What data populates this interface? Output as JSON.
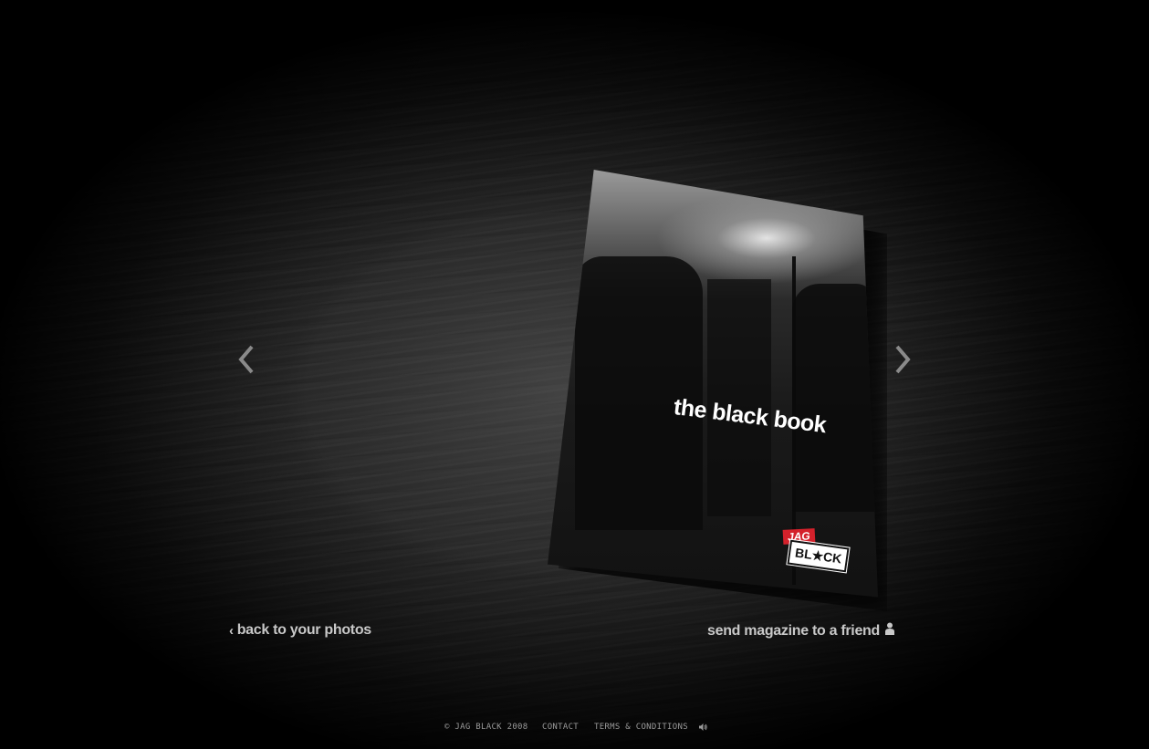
{
  "magazine": {
    "title": "the black book",
    "logo": {
      "top_text": "JAG",
      "bottom_text": "BL★CK",
      "accent_color": "#d4212b"
    }
  },
  "navigation": {
    "prev_icon": "chevron-left-icon",
    "next_icon": "chevron-right-icon"
  },
  "links": {
    "back_label": "back to your photos",
    "send_label": "send magazine to a friend"
  },
  "footer": {
    "copyright": "© JAG BLACK 2008",
    "contact": "CONTACT",
    "terms": "TERMS & CONDITIONS",
    "sound_icon": "speaker-icon"
  }
}
